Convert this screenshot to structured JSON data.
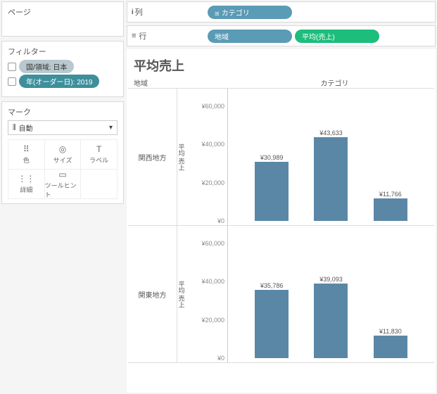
{
  "sidebar": {
    "pages_title": "ページ",
    "filters_title": "フィルター",
    "filters": [
      {
        "label": "国/領域: 日本",
        "style": "grey"
      },
      {
        "label": "年(オーダー日): 2019",
        "style": "teal"
      }
    ],
    "marks_title": "マーク",
    "marks_type": "自動",
    "mark_cards": [
      {
        "label": "色",
        "icon": "⠿"
      },
      {
        "label": "サイズ",
        "icon": "◎"
      },
      {
        "label": "ラベル",
        "icon": "T"
      },
      {
        "label": "詳細",
        "icon": "⋮⋮"
      },
      {
        "label": "ツールヒント",
        "icon": "▭"
      }
    ]
  },
  "shelves": {
    "columns_label": "列",
    "rows_label": "行",
    "columns": [
      {
        "label": "カテゴリ",
        "style": "blue",
        "icon": "⊞"
      }
    ],
    "rows": [
      {
        "label": "地域",
        "style": "blue"
      },
      {
        "label": "平均(売上)",
        "style": "green"
      }
    ]
  },
  "viz": {
    "title": "平均売上",
    "header_region": "地域",
    "header_category": "カテゴリ",
    "y_axis_label": "平均 売上"
  },
  "chart_data": {
    "type": "bar",
    "ylabel": "平均 売上",
    "ylim": [
      0,
      65000
    ],
    "y_ticks": [
      0,
      20000,
      40000,
      60000
    ],
    "y_tick_labels": [
      "¥0",
      "¥20,000",
      "¥40,000",
      "¥60,000"
    ],
    "currency_prefix": "¥",
    "facets": [
      {
        "region": "関西地方",
        "values": [
          30989,
          43633,
          11766
        ],
        "value_labels": [
          "¥30,989",
          "¥43,633",
          "¥11,766"
        ]
      },
      {
        "region": "関東地方",
        "values": [
          35786,
          39093,
          11830
        ],
        "value_labels": [
          "¥35,786",
          "¥39,093",
          "¥11,830"
        ]
      }
    ]
  }
}
